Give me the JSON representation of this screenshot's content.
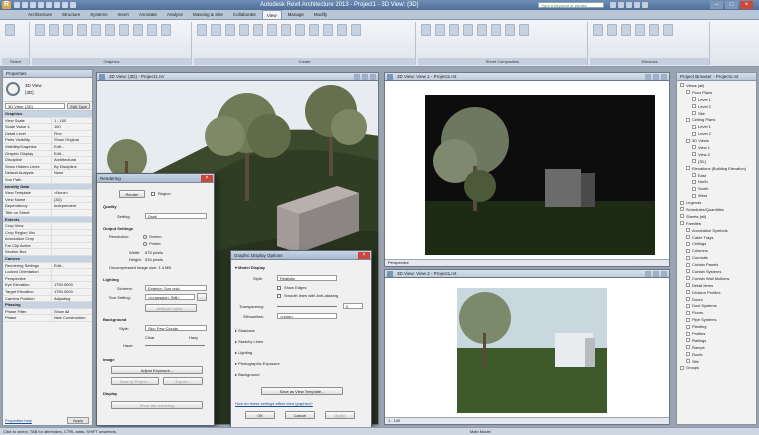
{
  "app": {
    "title": "Autodesk Revit Architecture 2013 - Project1 - 3D View: {3D}",
    "app_button": "R",
    "search_placeholder": "Type a keyword or phrase"
  },
  "tabs": [
    "Architecture",
    "Structure",
    "Systems",
    "Insert",
    "Annotate",
    "Analyze",
    "Massing & Site",
    "Collaborate",
    "View",
    "Manage",
    "Modify"
  ],
  "active_tab_index": 8,
  "ribbon": {
    "panels": [
      "Select",
      "Graphics",
      "Create",
      "Sheet Composition",
      "Windows"
    ]
  },
  "properties": {
    "title": "Properties",
    "type_name": "3D View",
    "type_sub": "{3D}",
    "selector": "3D View: {3D}",
    "edit_type": "Edit Type",
    "rows": [
      {
        "k": "Graphics",
        "v": "",
        "group": true
      },
      {
        "k": "View Scale",
        "v": "1 : 100"
      },
      {
        "k": "Scale Value 1:",
        "v": "100"
      },
      {
        "k": "Detail Level",
        "v": "Fine"
      },
      {
        "k": "Parts Visibility",
        "v": "Show Original"
      },
      {
        "k": "Visibility/Graphics",
        "v": "Edit..."
      },
      {
        "k": "Graphic Display",
        "v": "Edit..."
      },
      {
        "k": "Discipline",
        "v": "Architectural"
      },
      {
        "k": "Show Hidden Lines",
        "v": "By Discipline"
      },
      {
        "k": "Default Analysis",
        "v": "None"
      },
      {
        "k": "Sun Path",
        "v": ""
      },
      {
        "k": "Identity Data",
        "v": "",
        "group": true
      },
      {
        "k": "View Template",
        "v": "<None>"
      },
      {
        "k": "View Name",
        "v": "{3D}"
      },
      {
        "k": "Dependency",
        "v": "Independent"
      },
      {
        "k": "Title on Sheet",
        "v": ""
      },
      {
        "k": "Extents",
        "v": "",
        "group": true
      },
      {
        "k": "Crop View",
        "v": ""
      },
      {
        "k": "Crop Region Visi",
        "v": ""
      },
      {
        "k": "Annotation Crop",
        "v": ""
      },
      {
        "k": "Far Clip Active",
        "v": ""
      },
      {
        "k": "Section Box",
        "v": ""
      },
      {
        "k": "Camera",
        "v": "",
        "group": true
      },
      {
        "k": "Rendering Settings",
        "v": "Edit..."
      },
      {
        "k": "Locked Orientation",
        "v": ""
      },
      {
        "k": "Perspective",
        "v": ""
      },
      {
        "k": "Eye Elevation",
        "v": "1750.0000"
      },
      {
        "k": "Target Elevation",
        "v": "1750.0000"
      },
      {
        "k": "Camera Position",
        "v": "Adjusting"
      },
      {
        "k": "Phasing",
        "v": "",
        "group": true
      },
      {
        "k": "Phase Filter",
        "v": "Show All"
      },
      {
        "k": "Phase",
        "v": "New Construction"
      }
    ],
    "help_link": "Properties help",
    "apply": "Apply"
  },
  "views": {
    "v3d": {
      "title": "3D View: {3D} - Project1.rvt"
    },
    "cam1": {
      "title": "3D View: View 1 - Project1.rvt",
      "control": "Perspective"
    },
    "cam2": {
      "title": "3D View: View 2 - Project1.rvt",
      "control": "1 : 100"
    }
  },
  "rendering_dialog": {
    "title": "Rendering",
    "render_button": "Render",
    "region_label": "Region",
    "quality_label": "Quality",
    "setting_label": "Setting:",
    "setting_value": "Draft",
    "output_label": "Output Settings",
    "resolution_label": "Resolution:",
    "screen_option": "Screen",
    "printer_option": "Printer",
    "width_label": "Width:",
    "width_value": "675 pixels",
    "height_label": "Height:",
    "height_value": "534 pixels",
    "uncompressed": "Uncompressed image size: 1.4 MB",
    "lighting_label": "Lighting",
    "scheme_label": "Scheme:",
    "scheme_value": "Exterior: Sun only",
    "sun_label": "Sun Setting:",
    "sun_value": "<In-session, Still>",
    "artificial_button": "Artificial Lights...",
    "background_label": "Background",
    "style_label": "Style:",
    "style_value": "Sky: Few Clouds",
    "clear_label": "Clear",
    "hazy_label": "Hazy",
    "haze_label": "Haze:",
    "image_label": "Image",
    "adjust_button": "Adjust Exposure...",
    "save_button": "Save to Project...",
    "export_button": "Export...",
    "display_label": "Display",
    "show_button": "Show the rendering"
  },
  "graphic_dialog": {
    "title": "Graphic Display Options",
    "model_display": "Model Display",
    "style_label": "Style:",
    "style_value": "Realistic",
    "show_edges": "Show Edges",
    "smooth_lines": "Smooth lines with Anti-aliasing",
    "transparency_label": "Transparency:",
    "transparency_value": "0",
    "silhouettes_label": "Silhouettes:",
    "silhouettes_value": "<none>",
    "sections": [
      "Shadows",
      "Sketchy Lines",
      "Lighting",
      "Photographic Exposure",
      "Background"
    ],
    "save_template": "Save as View Template...",
    "more_link": "How do these settings affect view graphics?",
    "ok": "OK",
    "cancel": "Cancel",
    "apply": "Apply"
  },
  "project_browser": {
    "title": "Project Browser - Project1.rvt",
    "items": [
      "Views (all)",
      "Floor Plans",
      "Level 1",
      "Level 2",
      "Site",
      "Ceiling Plans",
      "Level 1",
      "Level 2",
      "3D Views",
      "View 1",
      "View 2",
      "{3D}",
      "Elevations (Building Elevation)",
      "East",
      "North",
      "South",
      "West",
      "Legends",
      "Schedules/Quantities",
      "Sheets (all)",
      "Families",
      "Annotation Symbols",
      "Cable Trays",
      "Ceilings",
      "Columns",
      "Conduits",
      "Curtain Panels",
      "Curtain Systems",
      "Curtain Wall Mullions",
      "Detail Items",
      "Division Profiles",
      "Doors",
      "Duct Systems",
      "Floors",
      "Pipe Systems",
      "Planting",
      "Profiles",
      "Railings",
      "Ramps",
      "Roofs",
      "Site",
      "Groups"
    ]
  },
  "status": {
    "text": "Click to select, TAB for alternates, CTRL adds, SHIFT unselects.",
    "model": "Main Model"
  }
}
